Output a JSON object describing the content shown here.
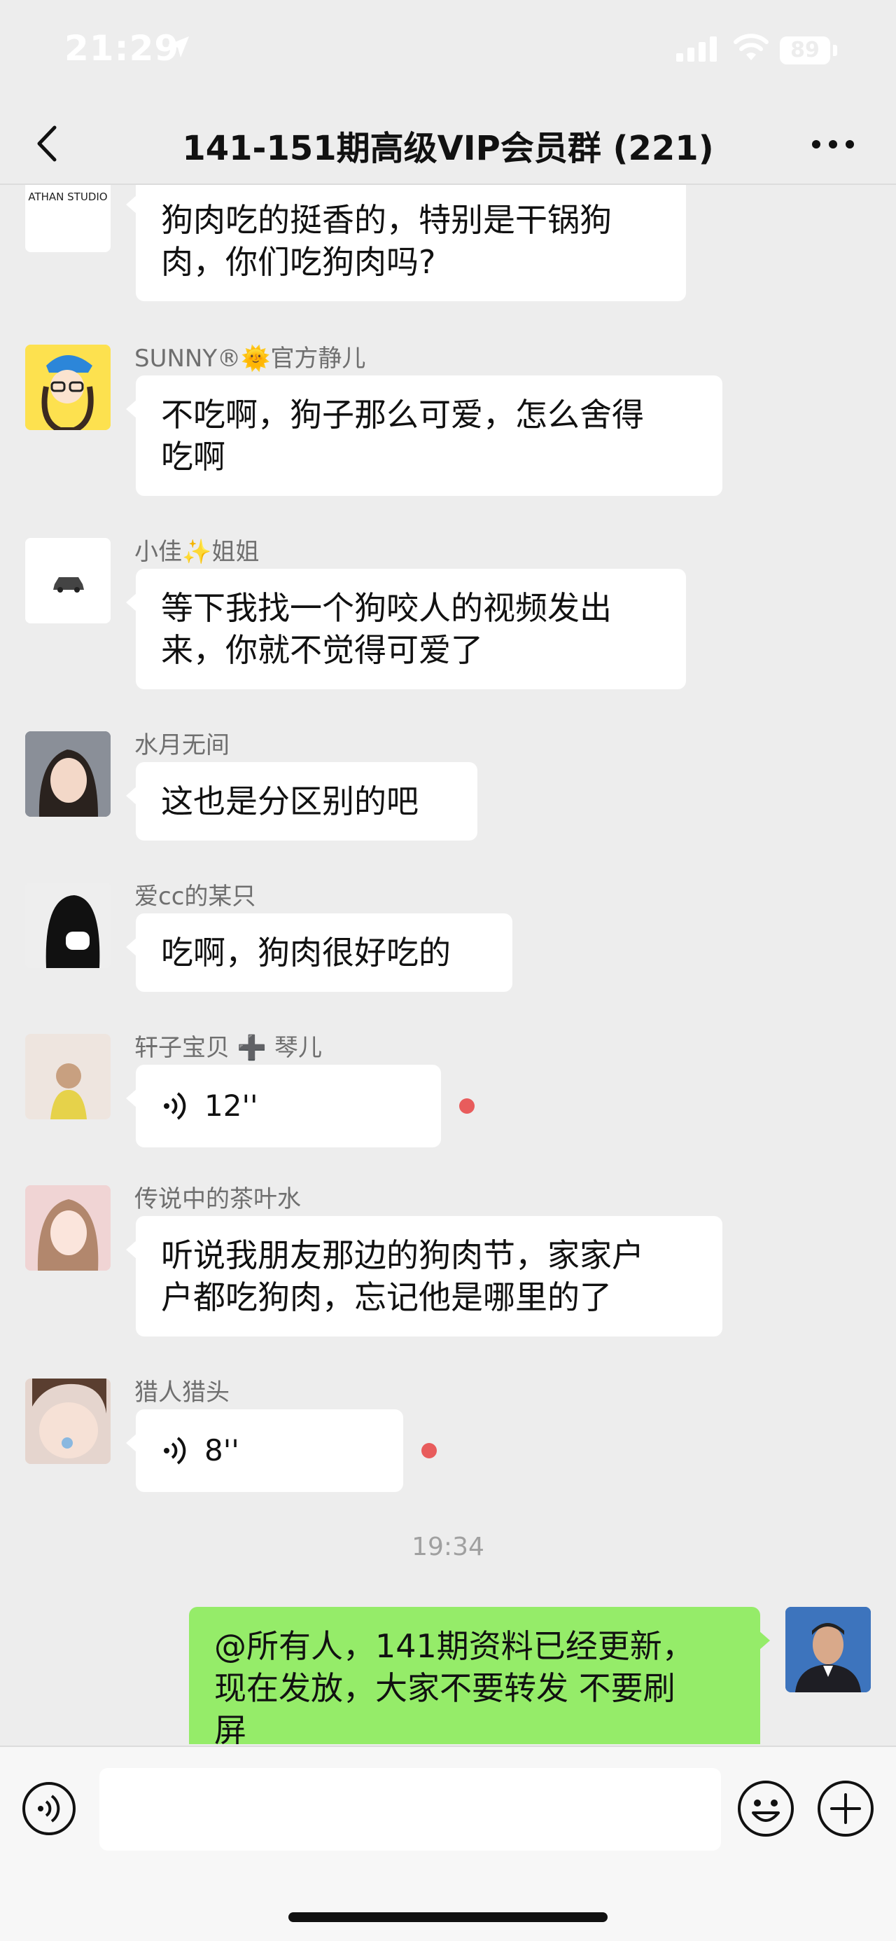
{
  "status_bar": {
    "time": "21:29",
    "battery": "89"
  },
  "header": {
    "title": "141-151期高级VIP会员群 (221)"
  },
  "messages": [
    {
      "sender": "",
      "avatar_label": "ATHAN STUDIO",
      "text_lines": [
        "狗肉吃的挺香的，特别是干锅狗",
        "肉，你们吃狗肉吗?"
      ]
    },
    {
      "sender": "SUNNY®🌞官方静儿",
      "text_lines": [
        "不吃啊，狗子那么可爱，怎么舍得",
        "吃啊"
      ]
    },
    {
      "sender": "小佳✨姐姐",
      "text_lines": [
        "等下我找一个狗咬人的视频发出",
        "来，你就不觉得可爱了"
      ]
    },
    {
      "sender": "水月无间",
      "text_lines": [
        "这也是分区别的吧"
      ]
    },
    {
      "sender": "爱cc的某只",
      "text_lines": [
        "吃啊，狗肉很好吃的"
      ]
    },
    {
      "sender": "轩子宝贝 ➕ 琴儿",
      "voice_duration": "12''"
    },
    {
      "sender": "传说中的茶叶水",
      "text_lines": [
        "听说我朋友那边的狗肉节，家家户",
        "户都吃狗肉，忘记他是哪里的了"
      ]
    },
    {
      "sender": "猎人猎头",
      "voice_duration": "8''"
    }
  ],
  "timestamp": "19:34",
  "my_message": {
    "text_lines": [
      "@所有人，141期资料已经更新，",
      "现在发放，大家不要转发 不要刷",
      "屏"
    ]
  },
  "colors": {
    "background": "#ededed",
    "bubble_mine": "#95ec69",
    "unread": "#e85c5c"
  }
}
